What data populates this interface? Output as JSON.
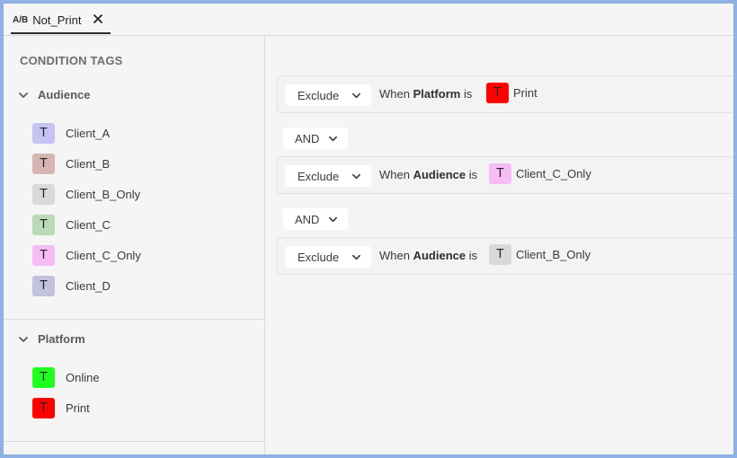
{
  "tab": {
    "prefix": "A/B",
    "title": "Not_Print"
  },
  "sidebar": {
    "title": "CONDITION TAGS",
    "groups": [
      {
        "label": "Audience",
        "items": [
          {
            "glyph": "T",
            "label": "Client_A",
            "color": "#c5c3f3"
          },
          {
            "glyph": "T",
            "label": "Client_B",
            "color": "#d6b6b3"
          },
          {
            "glyph": "T",
            "label": "Client_B_Only",
            "color": "#d9d9d9"
          },
          {
            "glyph": "T",
            "label": "Client_C",
            "color": "#b9d9b9"
          },
          {
            "glyph": "T",
            "label": "Client_C_Only",
            "color": "#f5bcf5"
          },
          {
            "glyph": "T",
            "label": "Client_D",
            "color": "#c2c1de"
          }
        ]
      },
      {
        "label": "Platform",
        "items": [
          {
            "glyph": "T",
            "label": "Online",
            "color": "#1eff1e"
          },
          {
            "glyph": "T",
            "label": "Print",
            "color": "#ff0000"
          }
        ]
      }
    ]
  },
  "conditions": [
    {
      "action": "Exclude",
      "when": "When",
      "field": "Platform",
      "is": "is",
      "tag_glyph": "T",
      "tag": "Print",
      "tag_color": "#ff0000"
    },
    {
      "action": "Exclude",
      "when": "When",
      "field": "Audience",
      "is": "is",
      "tag_glyph": "T",
      "tag": "Client_C_Only",
      "tag_color": "#f5bcf5"
    },
    {
      "action": "Exclude",
      "when": "When",
      "field": "Audience",
      "is": "is",
      "tag_glyph": "T",
      "tag": "Client_B_Only",
      "tag_color": "#d9d9d9"
    }
  ],
  "operators": [
    "AND",
    "AND"
  ],
  "icons": {
    "close": "close-icon",
    "chevron": "chevron-down-icon"
  }
}
